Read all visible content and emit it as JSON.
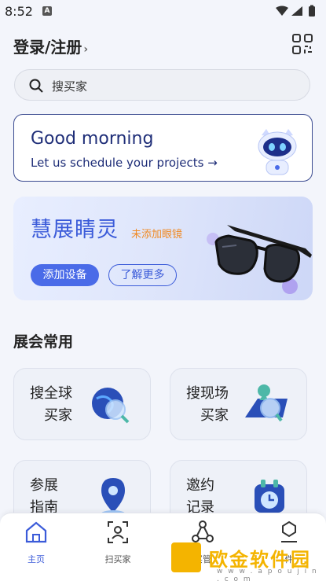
{
  "status_bar": {
    "time": "8:52",
    "app_badge": "A"
  },
  "header": {
    "login_label": "登录/注册",
    "chevron": "›"
  },
  "search": {
    "placeholder": "搜买家"
  },
  "greeting": {
    "title": "Good morning",
    "subtitle": "Let us schedule your projects →"
  },
  "hero": {
    "title": "慧展睛灵",
    "subtitle": "未添加眼镜",
    "add_device": "添加设备",
    "learn_more": "了解更多"
  },
  "section": {
    "title": "展会常用"
  },
  "cards": [
    {
      "line1": "搜全球",
      "line2": "买家"
    },
    {
      "line1": "搜现场",
      "line2": "买家"
    },
    {
      "line1": "参展",
      "line2": "指南"
    },
    {
      "line1": "邀约",
      "line2": "记录"
    }
  ],
  "tabs": [
    {
      "label": "主页"
    },
    {
      "label": "扫买家"
    },
    {
      "label": "买管"
    },
    {
      "label": "件"
    }
  ],
  "watermark": {
    "text": "欧金软件园",
    "url": "w w w . a p o u j i n . c o m"
  },
  "colors": {
    "accent": "#3b5bd9",
    "orange": "#f08a24",
    "greeting_border": "#3a4a90",
    "watermark": "#f4b400"
  }
}
